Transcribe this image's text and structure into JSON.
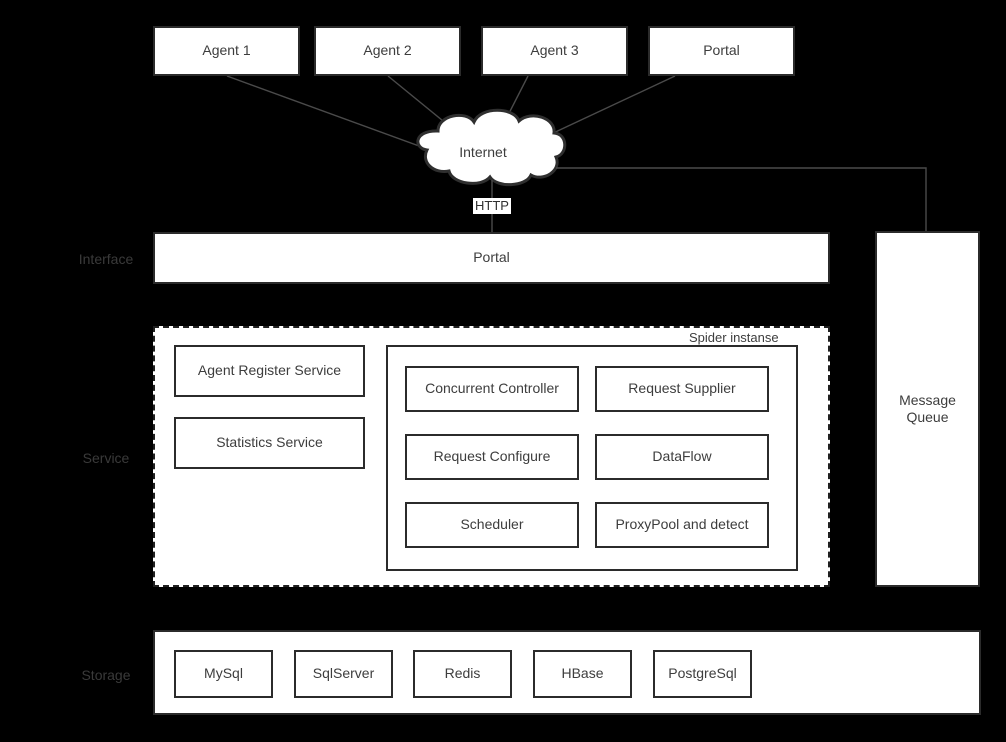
{
  "diagram": {
    "background_color": "#000000",
    "node_fill": "#ffffff",
    "node_stroke": "#2b2b2b",
    "text_color": "#3d3d3d",
    "tier_label_color": "#3a3a3a"
  },
  "clients": [
    {
      "label": "Agent 1"
    },
    {
      "label": "Agent 2"
    },
    {
      "label": "Agent 3"
    },
    {
      "label": "Portal"
    }
  ],
  "cloud": {
    "label": "Internet"
  },
  "connections": {
    "http_label": "HTTP"
  },
  "tiers": [
    {
      "label": "Interface"
    },
    {
      "label": "Service"
    },
    {
      "label": "Storage"
    }
  ],
  "interface": {
    "portal_label": "Portal"
  },
  "service": {
    "left_services": [
      {
        "label": "Agent Register Service"
      },
      {
        "label": "Statistics Service"
      }
    ],
    "spider_group_caption": "Spider instanse",
    "spider_components": [
      {
        "label": "Concurrent Controller"
      },
      {
        "label": "Request Supplier"
      },
      {
        "label": "Request Configure"
      },
      {
        "label": "DataFlow"
      },
      {
        "label": "Scheduler"
      },
      {
        "label": "ProxyPool and detect"
      }
    ]
  },
  "message_queue": {
    "label": "Message\nQueue",
    "line1": "Message",
    "line2": "Queue"
  },
  "storage": {
    "items": [
      {
        "label": "MySql"
      },
      {
        "label": "SqlServer"
      },
      {
        "label": "Redis"
      },
      {
        "label": "HBase"
      },
      {
        "label": "PostgreSql"
      }
    ]
  }
}
